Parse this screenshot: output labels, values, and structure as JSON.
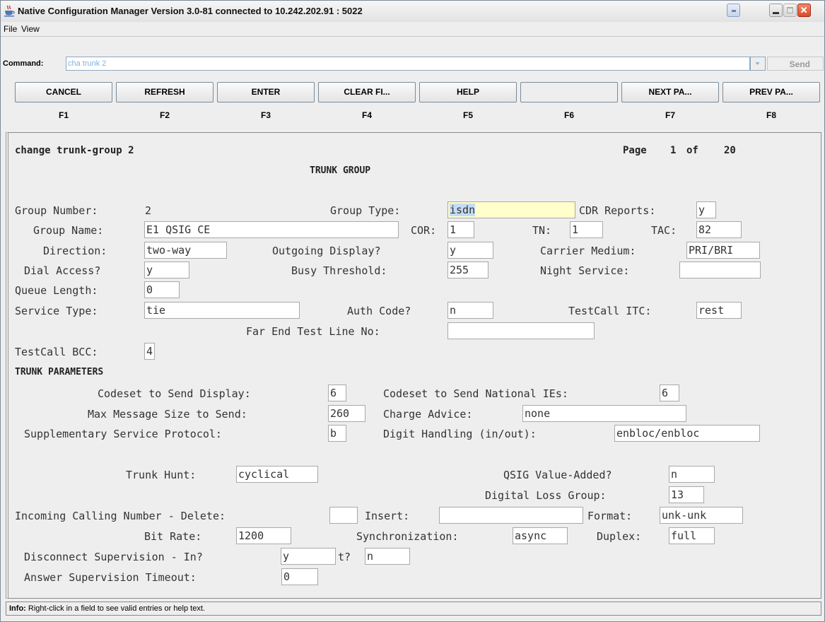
{
  "window": {
    "title": "Native Configuration Manager Version 3.0-81 connected to 10.242.202.91 : 5022"
  },
  "menu": [
    {
      "label": "File"
    },
    {
      "label": "View"
    }
  ],
  "command": {
    "label": "Command:",
    "value": "cha trunk 2",
    "send_label": "Send"
  },
  "function_keys": [
    {
      "label": "CANCEL",
      "key": "F1"
    },
    {
      "label": "REFRESH",
      "key": "F2"
    },
    {
      "label": "ENTER",
      "key": "F3"
    },
    {
      "label": "CLEAR FI...",
      "key": "F4"
    },
    {
      "label": "HELP",
      "key": "F5"
    },
    {
      "label": "",
      "key": "F6"
    },
    {
      "label": "NEXT PA...",
      "key": "F7"
    },
    {
      "label": "PREV PA...",
      "key": "F8"
    }
  ],
  "screen": {
    "heading": "change trunk-group 2",
    "page_label": "Page",
    "page_current": "1",
    "page_of": "of",
    "page_total": "20",
    "form_title": "TRUNK GROUP",
    "section_params": "TRUNK PARAMETERS"
  },
  "fields": {
    "group_number": {
      "label": "Group Number:",
      "value": "2"
    },
    "group_type": {
      "label": "Group Type:",
      "value": "isdn"
    },
    "cdr_reports": {
      "label": "CDR Reports:",
      "value": "y"
    },
    "group_name": {
      "label": "Group Name:",
      "value": "E1 QSIG CE"
    },
    "cor": {
      "label": "COR:",
      "value": "1"
    },
    "tn": {
      "label": "TN:",
      "value": "1"
    },
    "tac": {
      "label": "TAC:",
      "value": "82"
    },
    "direction": {
      "label": "Direction:",
      "value": "two-way"
    },
    "outgoing_display": {
      "label": "Outgoing Display?",
      "value": "y"
    },
    "carrier_medium": {
      "label": "Carrier Medium:",
      "value": "PRI/BRI"
    },
    "dial_access": {
      "label": "Dial Access?",
      "value": "y"
    },
    "busy_threshold": {
      "label": "Busy Threshold:",
      "value": "255"
    },
    "night_service": {
      "label": "Night Service:",
      "value": ""
    },
    "queue_length": {
      "label": "Queue Length:",
      "value": "0"
    },
    "service_type": {
      "label": "Service Type:",
      "value": "tie"
    },
    "auth_code": {
      "label": "Auth Code?",
      "value": "n"
    },
    "testcall_itc": {
      "label": "TestCall ITC:",
      "value": "rest"
    },
    "far_end_test_line": {
      "label": "Far End Test Line No:",
      "value": ""
    },
    "testcall_bcc": {
      "label": "TestCall BCC:",
      "value": "4"
    },
    "codeset_display": {
      "label": "Codeset to Send Display:",
      "value": "6"
    },
    "codeset_national": {
      "label": "Codeset to Send National IEs:",
      "value": "6"
    },
    "max_message_size": {
      "label": "Max Message Size to Send:",
      "value": "260"
    },
    "charge_advice": {
      "label": "Charge Advice:",
      "value": "none"
    },
    "supp_service_protocol": {
      "label": "Supplementary Service Protocol:",
      "value": "b"
    },
    "digit_handling": {
      "label": "Digit Handling (in/out):",
      "value": "enbloc/enbloc"
    },
    "trunk_hunt": {
      "label": "Trunk Hunt:",
      "value": "cyclical"
    },
    "qsig_value_added": {
      "label": "QSIG Value-Added?",
      "value": "n"
    },
    "digital_loss_group": {
      "label": "Digital Loss Group:",
      "value": "13"
    },
    "incoming_delete": {
      "label": "Incoming Calling Number - Delete:",
      "value": ""
    },
    "incoming_insert": {
      "label": "Insert:",
      "value": ""
    },
    "incoming_format": {
      "label": "Format:",
      "value": "unk-unk"
    },
    "bit_rate": {
      "label": "Bit Rate:",
      "value": "1200"
    },
    "synchronization": {
      "label": "Synchronization:",
      "value": "async"
    },
    "duplex": {
      "label": "Duplex:",
      "value": "full"
    },
    "disconnect_in": {
      "label": "Disconnect Supervision - In?",
      "value": "y"
    },
    "disconnect_out": {
      "label": "t?",
      "value": "n"
    },
    "answer_timeout": {
      "label": "Answer Supervision Timeout:",
      "value": "0"
    }
  },
  "info": {
    "label": "Info:",
    "text": "Right-click in a field to see valid entries or help text."
  },
  "colors": {
    "window_bg": "#eeeeee",
    "command_text": "#7fb0e0",
    "selected_field": "#ffffcc",
    "highlight": "#c4dcf4"
  },
  "icons": {
    "app": "java-cup-icon",
    "window_controls": [
      "special-icon",
      "minimize-icon",
      "maximize-icon",
      "close-icon"
    ]
  }
}
